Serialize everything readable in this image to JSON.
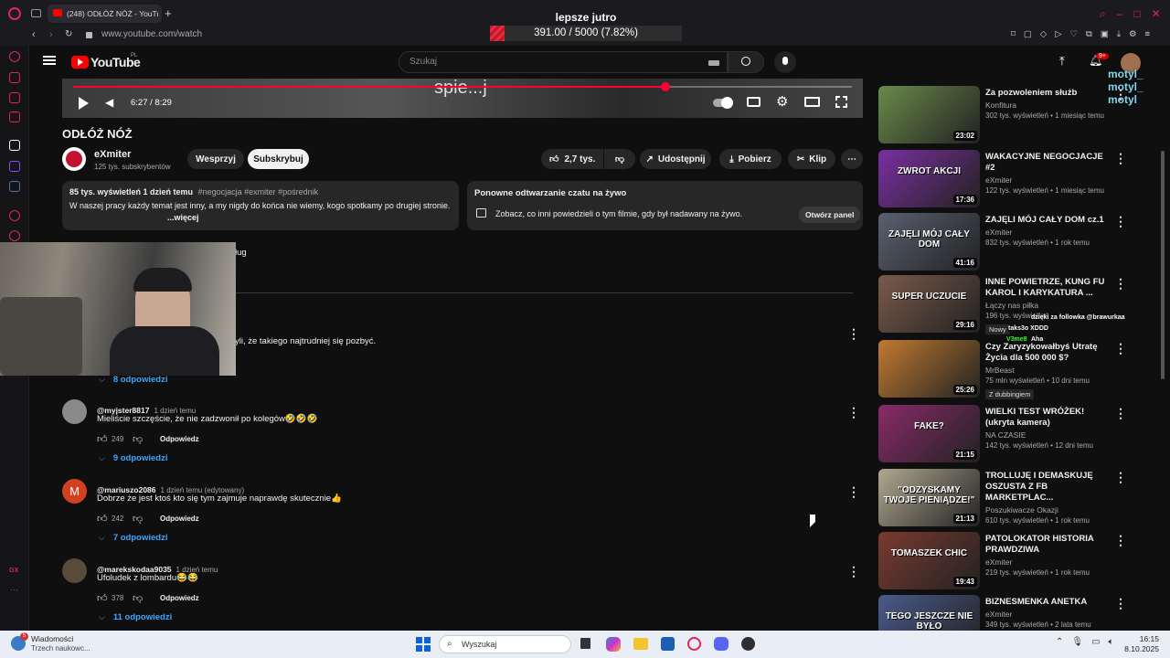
{
  "browser": {
    "tab_title": "(248) ODŁÓŻ NÓŻ - YouTube",
    "url": "www.youtube.com/watch",
    "notif_badge": "9+"
  },
  "overlay": {
    "goal_title": "lepsze jutro",
    "goal_progress_text": "391.00 / 5000 (7.82%)",
    "goal_fraction": 0.0782,
    "chat_names": [
      "motyl_",
      "motyl_",
      "motyl"
    ],
    "chat_lines": [
      {
        "user": "",
        "text": "dzięki za followka @brawurkaa"
      },
      {
        "user": "Nowy",
        "text": "taks3o XDDD"
      },
      {
        "user": "V3me8",
        "text": "Aha"
      }
    ]
  },
  "yt": {
    "logo_text": "YouTube",
    "logo_region": "PL",
    "search_placeholder": "Szukaj"
  },
  "player": {
    "subtitle": "spie...j",
    "time": "6:27 / 8:29",
    "progress_fraction": 0.76
  },
  "video": {
    "title": "ODŁÓŻ NÓŻ",
    "channel": "eXmiter",
    "subs": "125 tys. subskrybentów",
    "support_label": "Wesprzyj",
    "subscribe_label": "Subskrybuj",
    "likes": "2,7 tys.",
    "share_label": "Udostępnij",
    "download_label": "Pobierz",
    "clip_label": "Klip"
  },
  "description": {
    "stats": "85 tys. wyświetleń  1 dzień temu",
    "tags": "#negocjacja #exmiter #pośrednik",
    "text": "W naszej pracy każdy temat jest inny, a my nigdy do końca nie wiemy, kogo spotkamy po drugiej stronie.",
    "more": "...więcej"
  },
  "chat_replay": {
    "title": "Ponowne odtwarzanie czatu na żywo",
    "text": "Zobacz, co inni powiedzieli o tym filmie, gdy był nadawany na żywo.",
    "button": "Otwórz panel"
  },
  "partial": {
    "hidden_text": "ług",
    "first_comment_tail": "yli, że takiego najtrudniej się pozbyć.",
    "first_replies": "8 odpowiedzi"
  },
  "comments": [
    {
      "user": "@myjster8817",
      "time": "1 dzień temu",
      "text": "Mieliście szczęście, że nie zadzwonił po kolegów🤣🤣🤣",
      "likes": "249",
      "reply": "Odpowiedz",
      "replies": "9 odpowiedzi",
      "avatar": "",
      "avatar_color": "#8a8a8a"
    },
    {
      "user": "@mariuszo2086",
      "time": "1 dzień temu (edytowany)",
      "text": "Dobrze że jest ktoś kto się tym zajmuje naprawdę skutecznie👍",
      "likes": "242",
      "reply": "Odpowiedz",
      "replies": "7 odpowiedzi",
      "avatar": "M",
      "avatar_color": "#d1401f"
    },
    {
      "user": "@marekskodaa9035",
      "time": "1 dzień temu",
      "text": "Ufoludek z lombardu😂😂",
      "likes": "378",
      "reply": "Odpowiedz",
      "replies": "11 odpowiedzi",
      "avatar": "",
      "avatar_color": "#5a4a3a"
    }
  ],
  "recommended": [
    {
      "title": "Za pozwoleniem służb",
      "channel": "Konfitura",
      "meta": "302 tys. wyświetleń • 1 miesiąc temu",
      "duration": "23:02",
      "color": "#6a8a4a"
    },
    {
      "title": "WAKACYJNE NEGOCJACJE #2",
      "channel": "eXmiter",
      "meta": "122 tys. wyświetleń • 1 miesiąc temu",
      "duration": "17:36",
      "color": "#7a2fa0"
    },
    {
      "title": "ZAJĘLI MÓJ CAŁY DOM cz.1",
      "channel": "eXmiter",
      "meta": "832 tys. wyświetleń • 1 rok temu",
      "duration": "41:16",
      "color": "#5a6070"
    },
    {
      "title": "INNE POWIETRZE, KUNG FU KAROL I KARYKATURA ...",
      "channel": "Łączy nas piłka",
      "meta": "196 tys. wyświetleń",
      "duration": "29:16",
      "color": "#7a5a4a",
      "badge": "Nowy"
    },
    {
      "title": "Czy Zaryzykowałbyś Utratę Życia dla 500 000 $?",
      "channel": "MrBeast",
      "meta": "75 mln wyświetleń • 10 dni temu",
      "duration": "25:26",
      "color": "#c07a30",
      "badge": "Z dubbingiem"
    },
    {
      "title": "WIELKI TEST WRÓŻEK! (ukryta kamera)",
      "channel": "NA CZASIE",
      "meta": "142 tys. wyświetleń • 12 dni temu",
      "duration": "21:15",
      "color": "#8a2a6a"
    },
    {
      "title": "TROLLUJĘ I DEMASKUJĘ OSZUSTA Z FB MARKETPLAC...",
      "channel": "Poszukiwacze Okazji",
      "meta": "610 tys. wyświetleń • 1 rok temu",
      "duration": "21:13",
      "color": "#b0a890"
    },
    {
      "title": "PATOLOKATOR HISTORIA PRAWDZIWA",
      "channel": "eXmiter",
      "meta": "219 tys. wyświetleń • 1 rok temu",
      "duration": "19:43",
      "color": "#7a3a30"
    },
    {
      "title": "BIZNESMENKA ANETKA",
      "channel": "eXmiter",
      "meta": "349 tys. wyświetleń • 2 lata temu",
      "duration": "",
      "color": "#4a5a8a"
    }
  ],
  "thumb_texts": [
    "",
    "ZWROT AKCJI",
    "ZAJĘLI MÓJ CAŁY DOM",
    "SUPER UCZUCIE",
    "",
    "FAKE?",
    "\"ODZYSKAMY TWOJE PIENIĄDZE!\"",
    "TOMASZEK CHIC",
    "TEGO JESZCZE NIE BYŁO"
  ],
  "taskbar": {
    "weather_title": "Wiadomości",
    "weather_sub": "Trzech naukowc...",
    "weather_badge": "5",
    "search": "Wyszukaj",
    "time": "16:15",
    "date": "8.10.2025"
  }
}
